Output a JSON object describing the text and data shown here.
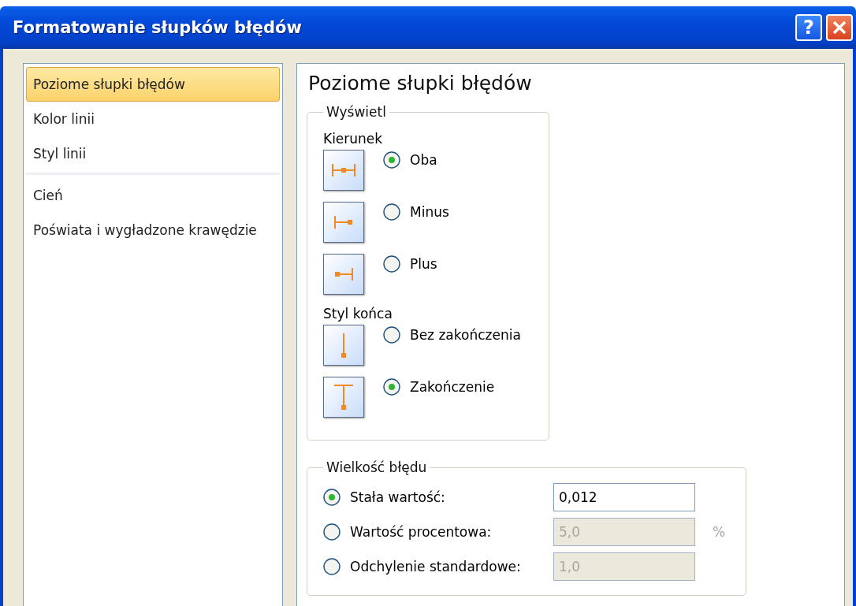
{
  "window": {
    "title": "Formatowanie słupków błędów",
    "buttons": [
      {
        "kind": "help",
        "label": "?"
      },
      {
        "kind": "close"
      }
    ]
  },
  "sidebar": {
    "groups": [
      {
        "items": [
          {
            "label": "Poziome słupki błędów",
            "selected": true
          },
          {
            "label": "Kolor linii",
            "selected": false
          },
          {
            "label": "Styl linii",
            "selected": false
          }
        ]
      },
      {
        "items": [
          {
            "label": "Cień",
            "selected": false
          },
          {
            "label": "Poświata i wygładzone krawędzie",
            "selected": false
          }
        ]
      }
    ]
  },
  "panel": {
    "heading": "Poziome słupki błędów",
    "display": {
      "legend": "Wyświetl",
      "sections": [
        {
          "label": "Kierunek",
          "options": [
            {
              "kind": "both",
              "label": "Oba",
              "selected": true
            },
            {
              "kind": "minus",
              "label": "Minus",
              "selected": false
            },
            {
              "kind": "plus",
              "label": "Plus",
              "selected": false
            }
          ]
        },
        {
          "label": "Styl końca",
          "options": [
            {
              "kind": "no_cap",
              "label": "Bez zakończenia",
              "selected": false
            },
            {
              "kind": "cap",
              "label": "Zakończenie",
              "selected": true
            }
          ]
        }
      ]
    },
    "error_amount": {
      "legend": "Wielkość błędu",
      "options": [
        {
          "label": "Stała wartość:",
          "value": "0,012",
          "selected": true,
          "disabled": false
        },
        {
          "label": "Wartość procentowa:",
          "value": "5,0",
          "unit": "%",
          "selected": false,
          "disabled": true
        },
        {
          "label": "Odchylenie standardowe:",
          "value": "1,0",
          "selected": false,
          "disabled": true
        }
      ]
    }
  }
}
